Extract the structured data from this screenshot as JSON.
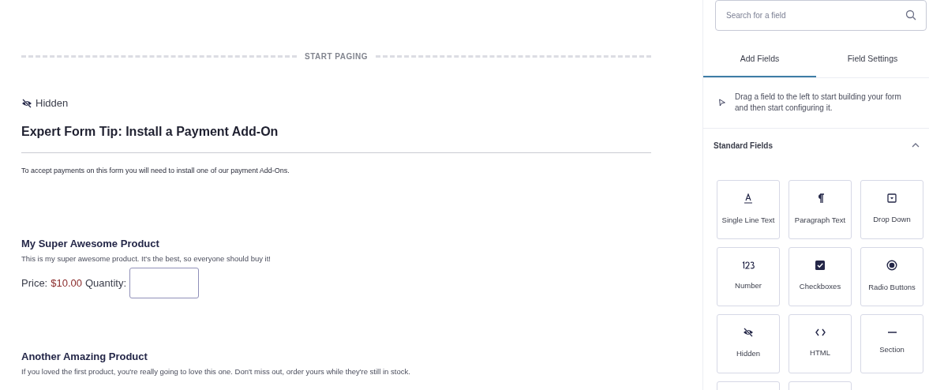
{
  "paging_divider": {
    "label": "START PAGING"
  },
  "hidden_label": "Hidden",
  "tip": {
    "title": "Expert Form Tip: Install a Payment Add-On",
    "text": "To accept payments on this form you will need to install one of our payment Add-Ons."
  },
  "products": [
    {
      "title": "My Super Awesome Product",
      "description": "This is my super awesome product. It's the best, so everyone should buy it!",
      "price_label": "Price:",
      "price": "$10.00",
      "quantity_label": "Quantity:"
    },
    {
      "title": "Another Amazing Product",
      "description": "If you loved the first product, you're really going to love this one. Don't miss out, order yours while they're still in stock."
    }
  ],
  "sidebar": {
    "search": {
      "placeholder": "Search for a field"
    },
    "tabs": [
      {
        "label": "Add Fields",
        "selected": true
      },
      {
        "label": "Field Settings",
        "selected": false
      }
    ],
    "hint": "Drag a field to the left to start building your form and then start configuring it.",
    "section": {
      "title": "Standard Fields",
      "expanded": true
    },
    "fields": [
      {
        "kind": "text",
        "label": "Single Line Text"
      },
      {
        "kind": "paragraph",
        "label": "Paragraph Text"
      },
      {
        "kind": "dropdown",
        "label": "Drop Down"
      },
      {
        "kind": "number",
        "label": "Number"
      },
      {
        "kind": "checkbox",
        "label": "Checkboxes"
      },
      {
        "kind": "radio",
        "label": "Radio Buttons"
      },
      {
        "kind": "hidden",
        "label": "Hidden"
      },
      {
        "kind": "html",
        "label": "HTML"
      },
      {
        "kind": "section",
        "label": "Section"
      },
      {
        "kind": "blank"
      },
      {
        "kind": "blank"
      }
    ]
  }
}
